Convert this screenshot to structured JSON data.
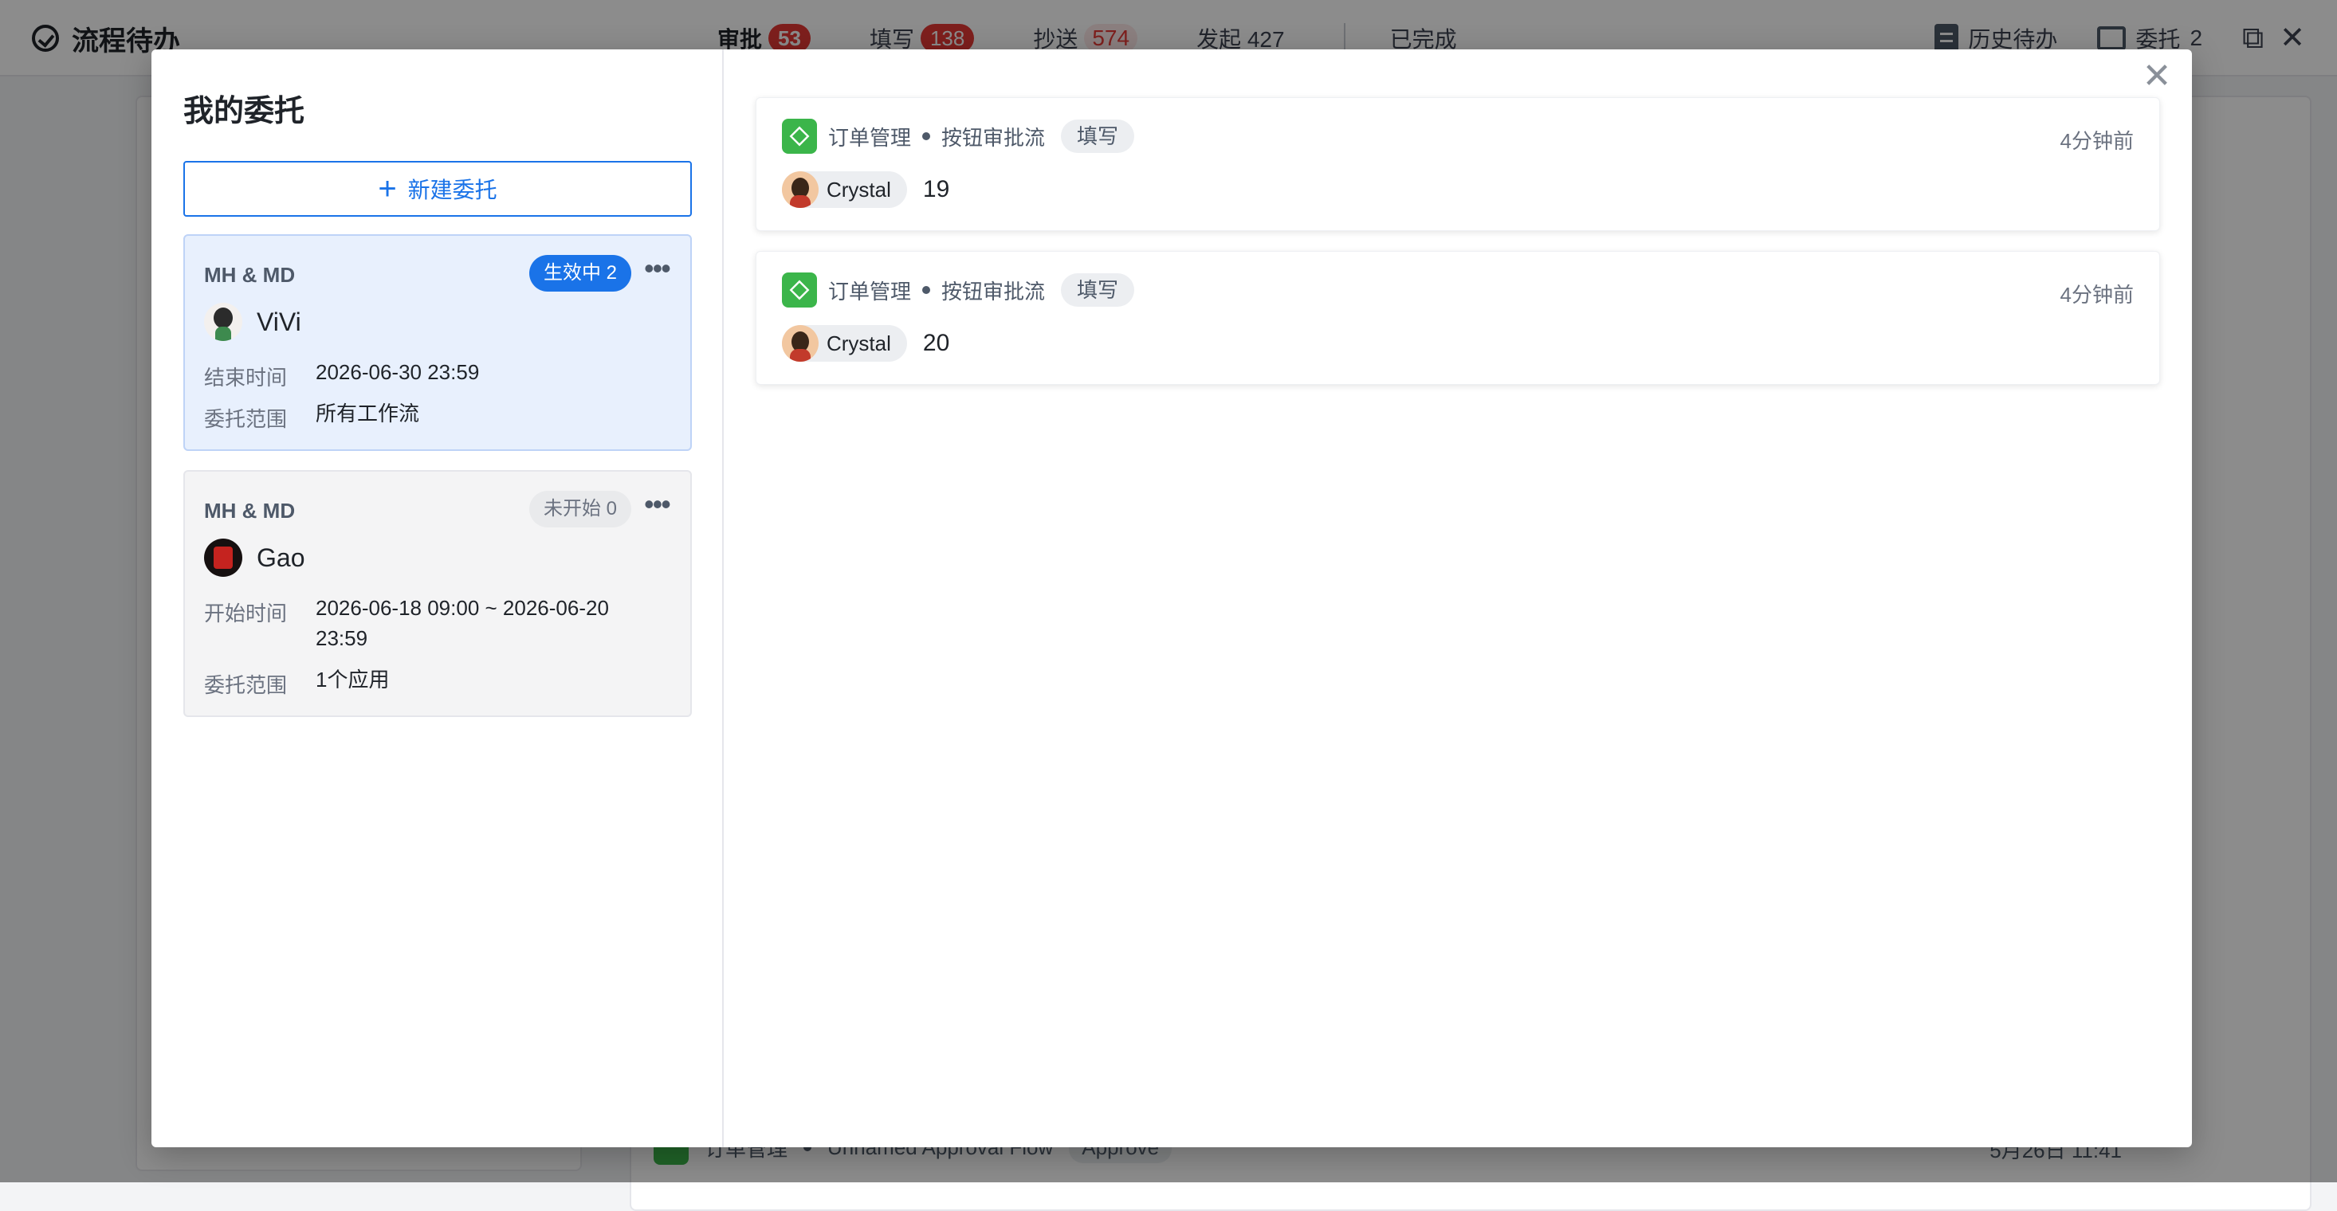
{
  "app": {
    "title": "流程待办",
    "tabs": [
      {
        "label": "审批",
        "count": "53"
      },
      {
        "label": "填写",
        "count": "138"
      },
      {
        "label": "抄送",
        "count": "574"
      },
      {
        "label": "发起 427"
      },
      {
        "label": "已完成"
      }
    ],
    "history_label": "历史待办",
    "delegate_label": "委托",
    "delegate_count": "2"
  },
  "background_row": {
    "app": "订单管理",
    "flow": "Unnamed Approval Flow",
    "tag": "Approve",
    "time": "5月26日 11:41"
  },
  "modal": {
    "title": "我的委托",
    "new_button": "新建委托",
    "delegations": [
      {
        "group": "MH & MD",
        "status": "生效中 2",
        "person": "ViVi",
        "time_label": "结束时间",
        "time_value": "2026-06-30 23:59",
        "scope_label": "委托范围",
        "scope_value": "所有工作流"
      },
      {
        "group": "MH & MD",
        "status": "未开始 0",
        "person": "Gao",
        "time_label": "开始时间",
        "time_value": "2026-06-18 09:00 ~ 2026-06-20 23:59",
        "scope_label": "委托范围",
        "scope_value": "1个应用"
      }
    ],
    "tasks": [
      {
        "app": "订单管理",
        "flow": "按钮审批流",
        "type": "填写",
        "time": "4分钟前",
        "user": "Crystal",
        "number": "19"
      },
      {
        "app": "订单管理",
        "flow": "按钮审批流",
        "type": "填写",
        "time": "4分钟前",
        "user": "Crystal",
        "number": "20"
      }
    ]
  },
  "colors": {
    "accent": "#1a73e8",
    "badge_red": "#e53935",
    "app_green": "#3bb54a"
  },
  "icons": [
    "check-circle-icon",
    "history-doc-icon",
    "delegate-icon",
    "external-link-icon",
    "close-icon",
    "plus-icon",
    "more-icon",
    "app-icon"
  ]
}
